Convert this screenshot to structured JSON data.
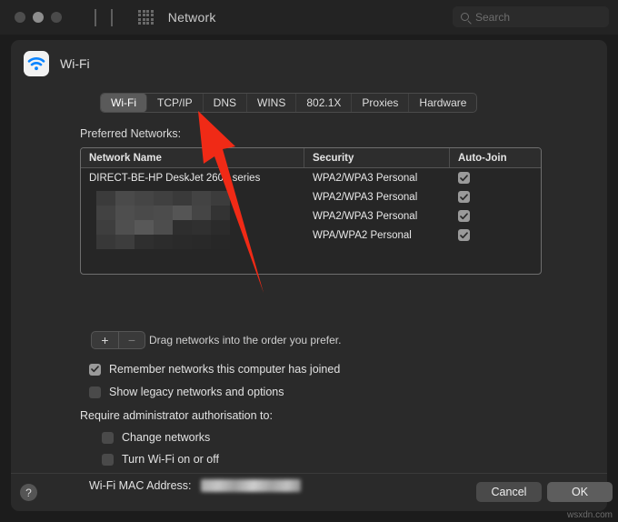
{
  "window": {
    "title": "Network",
    "traffic_lights": [
      "close",
      "minimize",
      "zoom"
    ],
    "nav_back_icon": "chevron-left-icon",
    "nav_forward_icon": "chevron-right-icon",
    "show_all_icon": "grid-dots-icon"
  },
  "search": {
    "placeholder": "Search",
    "icon": "search-icon"
  },
  "service": {
    "name": "Wi-Fi",
    "icon": "wifi-icon"
  },
  "tabs": [
    {
      "label": "Wi-Fi",
      "active": true
    },
    {
      "label": "TCP/IP",
      "active": false
    },
    {
      "label": "DNS",
      "active": false
    },
    {
      "label": "WINS",
      "active": false
    },
    {
      "label": "802.1X",
      "active": false
    },
    {
      "label": "Proxies",
      "active": false
    },
    {
      "label": "Hardware",
      "active": false
    }
  ],
  "preferred_networks": {
    "label": "Preferred Networks:",
    "columns": [
      "Network Name",
      "Security",
      "Auto-Join"
    ],
    "rows": [
      {
        "name": "DIRECT-BE-HP DeskJet 2600 series",
        "name_redacted": false,
        "security": "WPA2/WPA3 Personal",
        "auto_join": true
      },
      {
        "name": "",
        "name_redacted": true,
        "security": "WPA2/WPA3 Personal",
        "auto_join": true
      },
      {
        "name": "",
        "name_redacted": true,
        "security": "WPA2/WPA3 Personal",
        "auto_join": true
      },
      {
        "name": "",
        "name_redacted": true,
        "security": "WPA/WPA2 Personal",
        "auto_join": true
      }
    ],
    "add_button": "+",
    "remove_button": "−",
    "drag_hint": "Drag networks into the order you prefer."
  },
  "options": {
    "remember_networks": {
      "label": "Remember networks this computer has joined",
      "checked": true
    },
    "show_legacy": {
      "label": "Show legacy networks and options",
      "checked": false
    },
    "require_admin_label": "Require administrator authorisation to:",
    "change_networks": {
      "label": "Change networks",
      "checked": false
    },
    "turn_wifi": {
      "label": "Turn Wi-Fi on or off",
      "checked": false
    }
  },
  "mac": {
    "label": "Wi-Fi MAC Address:",
    "value_redacted": true
  },
  "footer": {
    "help_label": "?",
    "cancel_label": "Cancel",
    "ok_label": "OK"
  },
  "annotation": {
    "arrow_color": "#f02a16",
    "points_at": "TCP/IP"
  },
  "watermark": "wsxdn.com"
}
